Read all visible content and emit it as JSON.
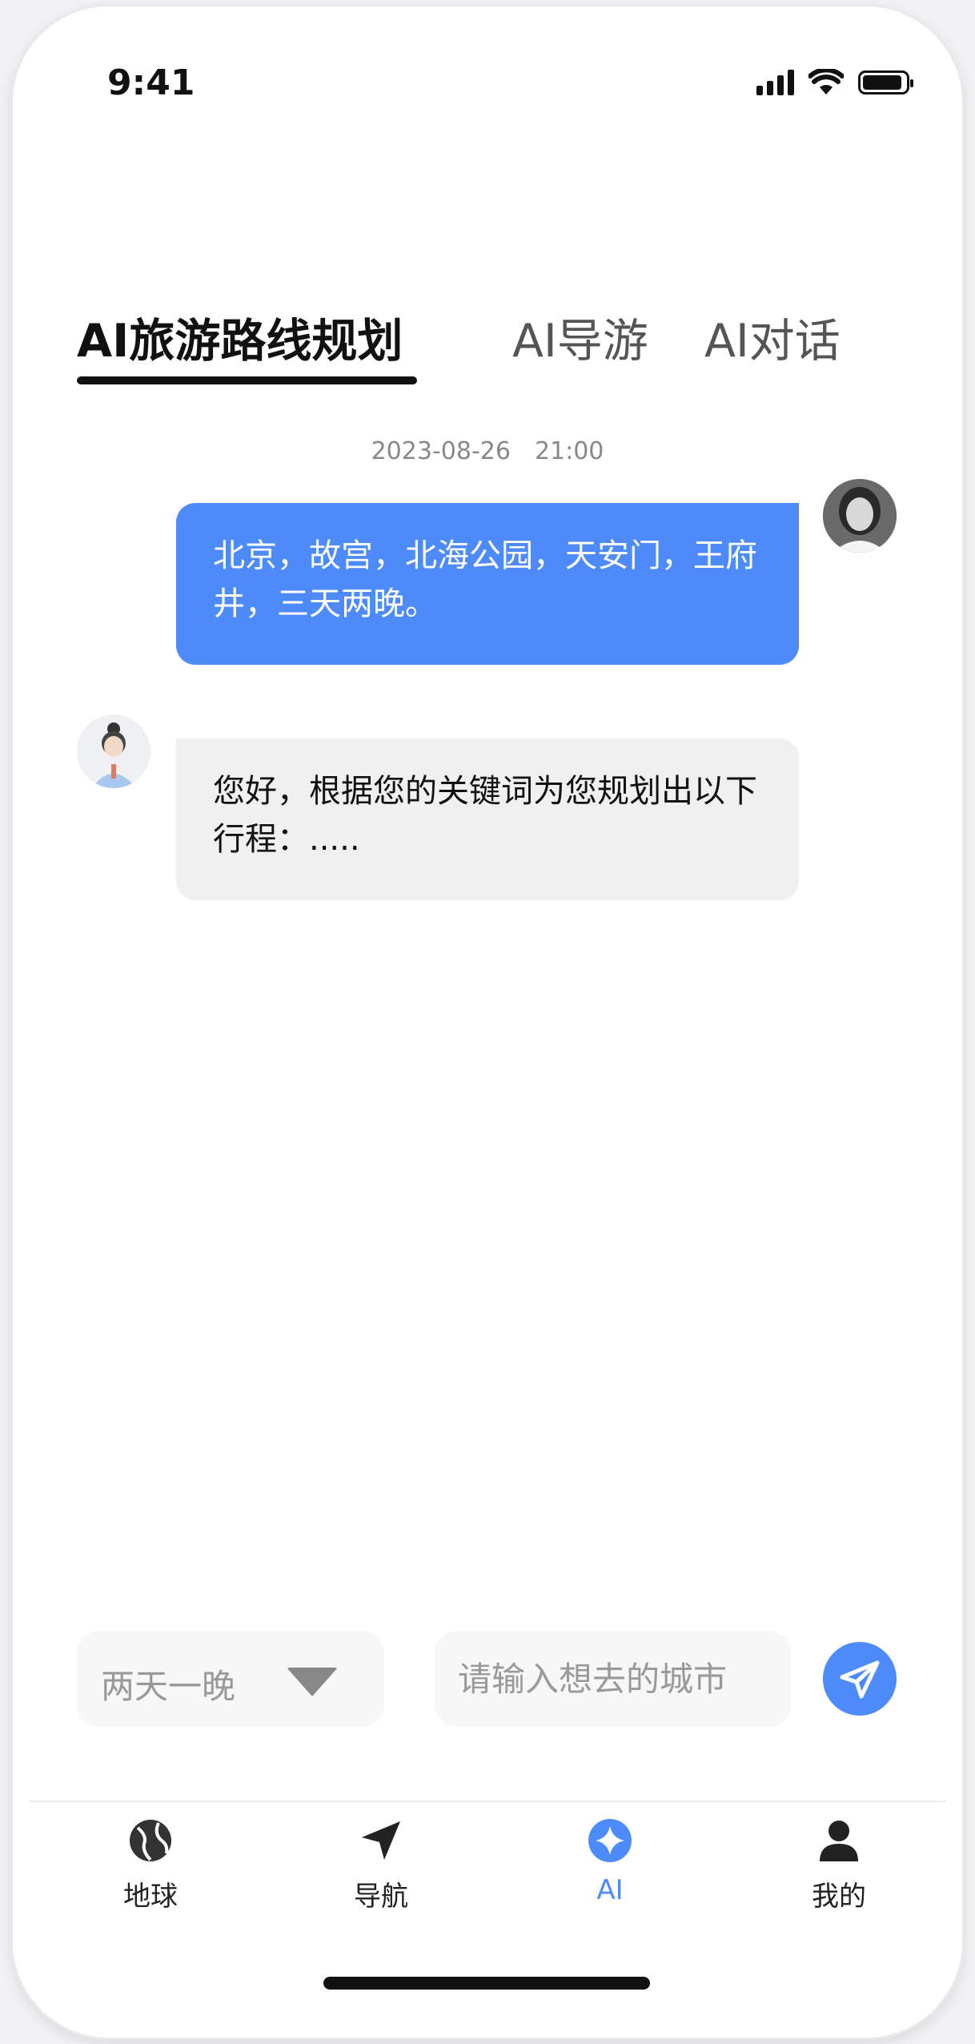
{
  "status_bar": {
    "time": "9:41"
  },
  "tabs": [
    {
      "label": "AI旅游路线规划",
      "active": true
    },
    {
      "label": "AI导游",
      "active": false
    },
    {
      "label": "AI对话",
      "active": false
    }
  ],
  "chat": {
    "timestamp": "2023-08-26　21:00",
    "messages": [
      {
        "role": "user",
        "text": "北京，故宫，北海公园，天安门，王府井，三天两晚。"
      },
      {
        "role": "ai",
        "text": "您好，根据您的关键词为您规划出以下行程：....."
      }
    ]
  },
  "input": {
    "duration_selected": "两天一晚",
    "city_placeholder": "请输入想去的城市"
  },
  "bottom_nav": [
    {
      "label": "地球",
      "icon": "globe-icon"
    },
    {
      "label": "导航",
      "icon": "navigation-arrow-icon"
    },
    {
      "label": "AI",
      "icon": "ai-sparkle-icon",
      "active": true
    },
    {
      "label": "我的",
      "icon": "user-icon"
    }
  ],
  "colors": {
    "accent": "#4e8bfa",
    "ai_bubble": "#f0f0f0",
    "text_dark": "#111111"
  }
}
